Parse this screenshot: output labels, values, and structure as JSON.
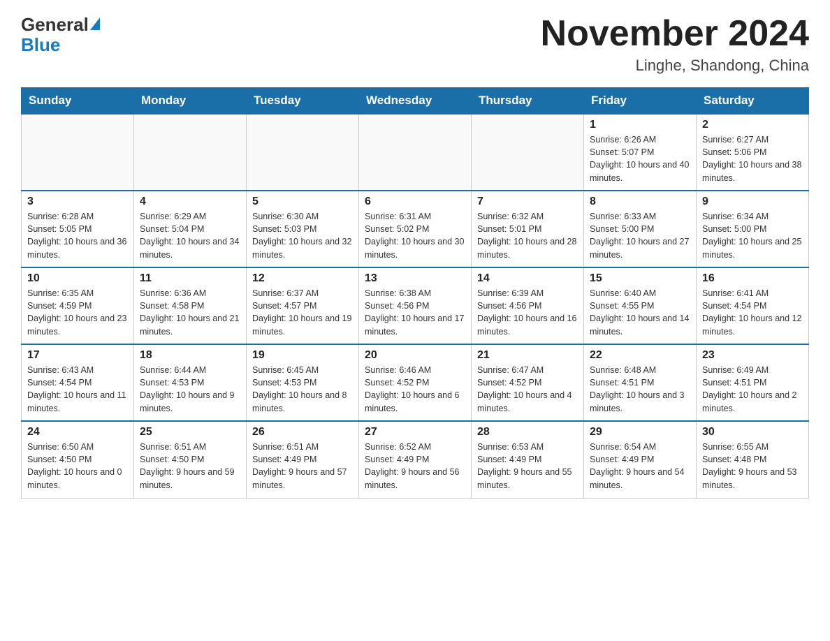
{
  "header": {
    "logo_general": "General",
    "logo_blue": "Blue",
    "month_title": "November 2024",
    "location": "Linghe, Shandong, China"
  },
  "weekdays": [
    "Sunday",
    "Monday",
    "Tuesday",
    "Wednesday",
    "Thursday",
    "Friday",
    "Saturday"
  ],
  "weeks": [
    [
      {
        "day": "",
        "info": ""
      },
      {
        "day": "",
        "info": ""
      },
      {
        "day": "",
        "info": ""
      },
      {
        "day": "",
        "info": ""
      },
      {
        "day": "",
        "info": ""
      },
      {
        "day": "1",
        "info": "Sunrise: 6:26 AM\nSunset: 5:07 PM\nDaylight: 10 hours and 40 minutes."
      },
      {
        "day": "2",
        "info": "Sunrise: 6:27 AM\nSunset: 5:06 PM\nDaylight: 10 hours and 38 minutes."
      }
    ],
    [
      {
        "day": "3",
        "info": "Sunrise: 6:28 AM\nSunset: 5:05 PM\nDaylight: 10 hours and 36 minutes."
      },
      {
        "day": "4",
        "info": "Sunrise: 6:29 AM\nSunset: 5:04 PM\nDaylight: 10 hours and 34 minutes."
      },
      {
        "day": "5",
        "info": "Sunrise: 6:30 AM\nSunset: 5:03 PM\nDaylight: 10 hours and 32 minutes."
      },
      {
        "day": "6",
        "info": "Sunrise: 6:31 AM\nSunset: 5:02 PM\nDaylight: 10 hours and 30 minutes."
      },
      {
        "day": "7",
        "info": "Sunrise: 6:32 AM\nSunset: 5:01 PM\nDaylight: 10 hours and 28 minutes."
      },
      {
        "day": "8",
        "info": "Sunrise: 6:33 AM\nSunset: 5:00 PM\nDaylight: 10 hours and 27 minutes."
      },
      {
        "day": "9",
        "info": "Sunrise: 6:34 AM\nSunset: 5:00 PM\nDaylight: 10 hours and 25 minutes."
      }
    ],
    [
      {
        "day": "10",
        "info": "Sunrise: 6:35 AM\nSunset: 4:59 PM\nDaylight: 10 hours and 23 minutes."
      },
      {
        "day": "11",
        "info": "Sunrise: 6:36 AM\nSunset: 4:58 PM\nDaylight: 10 hours and 21 minutes."
      },
      {
        "day": "12",
        "info": "Sunrise: 6:37 AM\nSunset: 4:57 PM\nDaylight: 10 hours and 19 minutes."
      },
      {
        "day": "13",
        "info": "Sunrise: 6:38 AM\nSunset: 4:56 PM\nDaylight: 10 hours and 17 minutes."
      },
      {
        "day": "14",
        "info": "Sunrise: 6:39 AM\nSunset: 4:56 PM\nDaylight: 10 hours and 16 minutes."
      },
      {
        "day": "15",
        "info": "Sunrise: 6:40 AM\nSunset: 4:55 PM\nDaylight: 10 hours and 14 minutes."
      },
      {
        "day": "16",
        "info": "Sunrise: 6:41 AM\nSunset: 4:54 PM\nDaylight: 10 hours and 12 minutes."
      }
    ],
    [
      {
        "day": "17",
        "info": "Sunrise: 6:43 AM\nSunset: 4:54 PM\nDaylight: 10 hours and 11 minutes."
      },
      {
        "day": "18",
        "info": "Sunrise: 6:44 AM\nSunset: 4:53 PM\nDaylight: 10 hours and 9 minutes."
      },
      {
        "day": "19",
        "info": "Sunrise: 6:45 AM\nSunset: 4:53 PM\nDaylight: 10 hours and 8 minutes."
      },
      {
        "day": "20",
        "info": "Sunrise: 6:46 AM\nSunset: 4:52 PM\nDaylight: 10 hours and 6 minutes."
      },
      {
        "day": "21",
        "info": "Sunrise: 6:47 AM\nSunset: 4:52 PM\nDaylight: 10 hours and 4 minutes."
      },
      {
        "day": "22",
        "info": "Sunrise: 6:48 AM\nSunset: 4:51 PM\nDaylight: 10 hours and 3 minutes."
      },
      {
        "day": "23",
        "info": "Sunrise: 6:49 AM\nSunset: 4:51 PM\nDaylight: 10 hours and 2 minutes."
      }
    ],
    [
      {
        "day": "24",
        "info": "Sunrise: 6:50 AM\nSunset: 4:50 PM\nDaylight: 10 hours and 0 minutes."
      },
      {
        "day": "25",
        "info": "Sunrise: 6:51 AM\nSunset: 4:50 PM\nDaylight: 9 hours and 59 minutes."
      },
      {
        "day": "26",
        "info": "Sunrise: 6:51 AM\nSunset: 4:49 PM\nDaylight: 9 hours and 57 minutes."
      },
      {
        "day": "27",
        "info": "Sunrise: 6:52 AM\nSunset: 4:49 PM\nDaylight: 9 hours and 56 minutes."
      },
      {
        "day": "28",
        "info": "Sunrise: 6:53 AM\nSunset: 4:49 PM\nDaylight: 9 hours and 55 minutes."
      },
      {
        "day": "29",
        "info": "Sunrise: 6:54 AM\nSunset: 4:49 PM\nDaylight: 9 hours and 54 minutes."
      },
      {
        "day": "30",
        "info": "Sunrise: 6:55 AM\nSunset: 4:48 PM\nDaylight: 9 hours and 53 minutes."
      }
    ]
  ]
}
